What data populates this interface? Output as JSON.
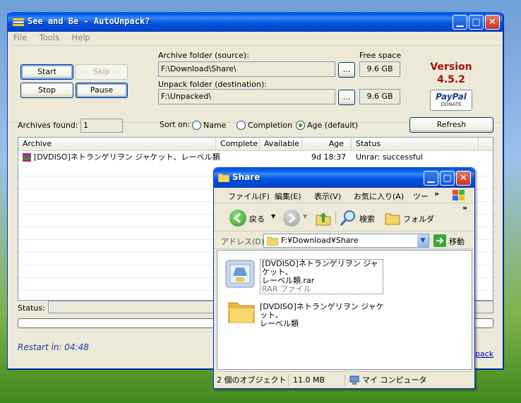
{
  "main_window": {
    "title": "See and Be - AutoUnpack?",
    "menu": [
      "File",
      "Tools",
      "Help"
    ],
    "buttons": {
      "start": "Start",
      "skip": "Skip",
      "stop": "Stop",
      "pause": "Pause",
      "browse": "...",
      "refresh": "Refresh"
    },
    "archive_folder_label": "Archive folder (source):",
    "archive_folder_value": "F:\\Download\\Share\\",
    "unpack_folder_label": "Unpack folder (destination):",
    "unpack_folder_value": "F:\\Unpacked\\",
    "free_space_label": "Free space",
    "free_space_source": "9.6 GB",
    "free_space_dest": "9.6 GB",
    "version_label": "Version",
    "version_number": "4.5.2",
    "paypal_text": "PayPal",
    "donate_text": "DONATE",
    "archives_found_label": "Archives found:",
    "archives_found_value": "1",
    "sort_label": "Sort on:",
    "sort_options": [
      "Name",
      "Completion",
      "Age (default)"
    ],
    "sort_selected": "Age (default)",
    "columns": [
      "Archive",
      "Complete",
      "Available",
      "Age",
      "Status"
    ],
    "rows": [
      {
        "archive": "[DVDISO]ネトランゲリヲン ジャケット、レーベル類",
        "complete": "",
        "available": "",
        "age": "9d 18:37",
        "status": "Unrar: successful"
      }
    ],
    "status_label": "Status:",
    "restart_text": "Restart in: 04:48",
    "link_fragment": "pack"
  },
  "explorer_window": {
    "title": "Share",
    "menu": [
      "ファイル(F)",
      "編集(E)",
      "表示(V)",
      "お気に入り(A)",
      "ツー"
    ],
    "back_label": "戻る",
    "search_label": "検索",
    "folders_label": "フォルダ",
    "address_label": "アドレス(D)",
    "address_value": "F:¥Download¥Share",
    "go_label": "移動",
    "items": [
      {
        "name_line1": "[DVDISO]ネトランゲリヲン ジャケット、",
        "name_line2": "レーベル類.rar",
        "type": "RAR ファイル"
      },
      {
        "name_line1": "[DVDISO]ネトランゲリヲン ジャケット、",
        "name_line2": "レーベル類",
        "type": ""
      }
    ],
    "status_count": "2 個のオブジェクト",
    "status_size": "11.0 MB",
    "status_location": "マイ コンピュータ"
  }
}
